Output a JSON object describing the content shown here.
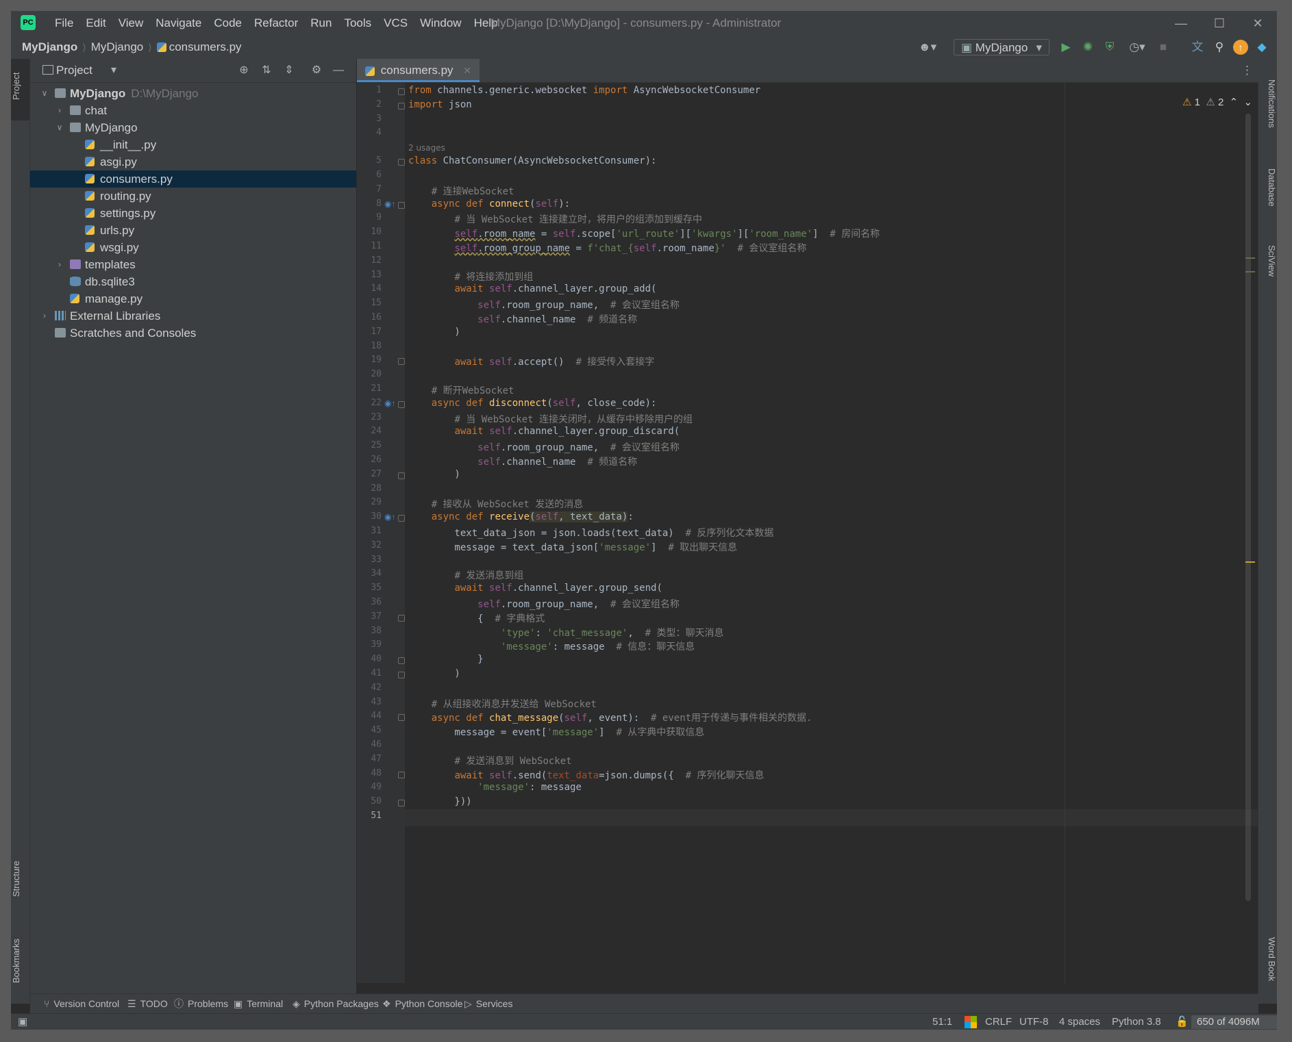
{
  "window": {
    "menus": [
      "File",
      "Edit",
      "View",
      "Navigate",
      "Code",
      "Refactor",
      "Run",
      "Tools",
      "VCS",
      "Window",
      "Help"
    ],
    "title": "MyDjango [D:\\MyDjango] - consumers.py - Administrator"
  },
  "navbar": {
    "crumbs": [
      "MyDjango",
      "MyDjango",
      "consumers.py"
    ],
    "run_config": "MyDjango"
  },
  "project": {
    "title": "Project",
    "tree": [
      {
        "label": "MyDjango",
        "hint": "D:\\MyDjango",
        "depth": 0,
        "type": "folder",
        "open": true,
        "bold": true
      },
      {
        "label": "chat",
        "depth": 1,
        "type": "folder",
        "open": false
      },
      {
        "label": "MyDjango",
        "depth": 1,
        "type": "folder",
        "open": true
      },
      {
        "label": "__init__.py",
        "depth": 2,
        "type": "py"
      },
      {
        "label": "asgi.py",
        "depth": 2,
        "type": "py"
      },
      {
        "label": "consumers.py",
        "depth": 2,
        "type": "py",
        "selected": true
      },
      {
        "label": "routing.py",
        "depth": 2,
        "type": "py"
      },
      {
        "label": "settings.py",
        "depth": 2,
        "type": "py"
      },
      {
        "label": "urls.py",
        "depth": 2,
        "type": "py"
      },
      {
        "label": "wsgi.py",
        "depth": 2,
        "type": "py"
      },
      {
        "label": "templates",
        "depth": 1,
        "type": "folder-purple",
        "open": false
      },
      {
        "label": "db.sqlite3",
        "depth": 1,
        "type": "db"
      },
      {
        "label": "manage.py",
        "depth": 1,
        "type": "py"
      },
      {
        "label": "External Libraries",
        "depth": 0,
        "type": "lib",
        "open": false
      },
      {
        "label": "Scratches and Consoles",
        "depth": 0,
        "type": "scratch"
      }
    ]
  },
  "side_tabs": {
    "left": [
      "Project",
      "Structure",
      "Bookmarks"
    ],
    "right": [
      "Notifications",
      "Database",
      "SciView",
      "Word Book"
    ]
  },
  "editor": {
    "tab": "consumers.py",
    "inspections": {
      "warnings": "1",
      "weak_warnings": "2"
    },
    "usages_hint": "2 usages",
    "current_line": 51,
    "lines": [
      [
        [
          "kw",
          "from "
        ],
        [
          "",
          "channels.generic.websocket "
        ],
        [
          "kw",
          "import "
        ],
        [
          "",
          "AsyncWebsocketConsumer"
        ]
      ],
      [
        [
          "kw",
          "import "
        ],
        [
          "",
          "json"
        ]
      ],
      [],
      [],
      [
        [
          "kw",
          "class "
        ],
        [
          "",
          "ChatConsumer(AsyncWebsocketConsumer):"
        ]
      ],
      [],
      [
        [
          "",
          "    "
        ],
        [
          "cm",
          "# 连接WebSocket"
        ]
      ],
      [
        [
          "",
          "    "
        ],
        [
          "kw",
          "async def "
        ],
        [
          "fn",
          "connect"
        ],
        [
          "",
          "("
        ],
        [
          "sf",
          "self"
        ],
        [
          "",
          "):"
        ]
      ],
      [
        [
          "",
          "        "
        ],
        [
          "cm",
          "# 当 WebSocket 连接建立时，将用户的组添加到缓存中"
        ]
      ],
      [
        [
          "",
          "        "
        ],
        [
          "sf wavy",
          "self"
        ],
        [
          "wavy",
          ".room_name"
        ],
        [
          "",
          " = "
        ],
        [
          "sf",
          "self"
        ],
        [
          "",
          ".scope["
        ],
        [
          "st",
          "'url_route'"
        ],
        [
          "",
          "]["
        ],
        [
          "st",
          "'kwargs'"
        ],
        [
          "",
          "]["
        ],
        [
          "st",
          "'room_name'"
        ],
        [
          "",
          "]  "
        ],
        [
          "cm",
          "# 房间名称"
        ]
      ],
      [
        [
          "",
          "        "
        ],
        [
          "sf wavy",
          "self"
        ],
        [
          "wavy",
          ".room_group_name"
        ],
        [
          "",
          " = "
        ],
        [
          "st",
          "f'chat_{"
        ],
        [
          "sf",
          "self"
        ],
        [
          "",
          ".room_name"
        ],
        [
          "st",
          "}'"
        ],
        [
          "",
          "  "
        ],
        [
          "cm",
          "# 会议室组名称"
        ]
      ],
      [],
      [
        [
          "",
          "        "
        ],
        [
          "cm",
          "# 将连接添加到组"
        ]
      ],
      [
        [
          "",
          "        "
        ],
        [
          "kw",
          "await "
        ],
        [
          "sf",
          "self"
        ],
        [
          "",
          ".channel_layer.group_add("
        ]
      ],
      [
        [
          "",
          "            "
        ],
        [
          "sf",
          "self"
        ],
        [
          "",
          ".room_group_name,  "
        ],
        [
          "cm",
          "# 会议室组名称"
        ]
      ],
      [
        [
          "",
          "            "
        ],
        [
          "sf",
          "self"
        ],
        [
          "",
          ".channel_name  "
        ],
        [
          "cm",
          "# 频道名称"
        ]
      ],
      [
        [
          "",
          "        )"
        ]
      ],
      [],
      [
        [
          "",
          "        "
        ],
        [
          "kw",
          "await "
        ],
        [
          "sf",
          "self"
        ],
        [
          "",
          ".accept()  "
        ],
        [
          "cm",
          "# 接受传入套接字"
        ]
      ],
      [],
      [
        [
          "",
          "    "
        ],
        [
          "cm",
          "# 断开WebSocket"
        ]
      ],
      [
        [
          "",
          "    "
        ],
        [
          "kw",
          "async def "
        ],
        [
          "fn",
          "disconnect"
        ],
        [
          "",
          "("
        ],
        [
          "sf",
          "self"
        ],
        [
          "",
          ", close_code):"
        ]
      ],
      [
        [
          "",
          "        "
        ],
        [
          "cm",
          "# 当 WebSocket 连接关闭时，从缓存中移除用户的组"
        ]
      ],
      [
        [
          "",
          "        "
        ],
        [
          "kw",
          "await "
        ],
        [
          "sf",
          "self"
        ],
        [
          "",
          ".channel_layer.group_discard("
        ]
      ],
      [
        [
          "",
          "            "
        ],
        [
          "sf",
          "self"
        ],
        [
          "",
          ".room_group_name,  "
        ],
        [
          "cm",
          "# 会议室组名称"
        ]
      ],
      [
        [
          "",
          "            "
        ],
        [
          "sf",
          "self"
        ],
        [
          "",
          ".channel_name  "
        ],
        [
          "cm",
          "# 频道名称"
        ]
      ],
      [
        [
          "",
          "        )"
        ]
      ],
      [],
      [
        [
          "",
          "    "
        ],
        [
          "cm",
          "# 接收从 WebSocket 发送的消息"
        ]
      ],
      [
        [
          "",
          "    "
        ],
        [
          "kw",
          "async def "
        ],
        [
          "fn",
          "receive"
        ],
        [
          "hl",
          "("
        ],
        [
          "sf hl",
          "self"
        ],
        [
          "hl",
          ", text_data)"
        ],
        [
          "",
          ":"
        ]
      ],
      [
        [
          "",
          "        text_data_json = json.loads(text_data)  "
        ],
        [
          "cm",
          "# 反序列化文本数据"
        ]
      ],
      [
        [
          "",
          "        message = text_data_json["
        ],
        [
          "st",
          "'message'"
        ],
        [
          "",
          "]  "
        ],
        [
          "cm",
          "# 取出聊天信息"
        ]
      ],
      [],
      [
        [
          "",
          "        "
        ],
        [
          "cm",
          "# 发送消息到组"
        ]
      ],
      [
        [
          "",
          "        "
        ],
        [
          "kw",
          "await "
        ],
        [
          "sf",
          "self"
        ],
        [
          "",
          ".channel_layer.group_send("
        ]
      ],
      [
        [
          "",
          "            "
        ],
        [
          "sf",
          "self"
        ],
        [
          "",
          ".room_group_name,  "
        ],
        [
          "cm",
          "# 会议室组名称"
        ]
      ],
      [
        [
          "",
          "            {  "
        ],
        [
          "cm",
          "# 字典格式"
        ]
      ],
      [
        [
          "",
          "                "
        ],
        [
          "st",
          "'type'"
        ],
        [
          "",
          ": "
        ],
        [
          "st",
          "'chat_message'"
        ],
        [
          "",
          ",  "
        ],
        [
          "cm",
          "# 类型：聊天消息"
        ]
      ],
      [
        [
          "",
          "                "
        ],
        [
          "st",
          "'message'"
        ],
        [
          "",
          ": message  "
        ],
        [
          "cm",
          "# 信息：聊天信息"
        ]
      ],
      [
        [
          "",
          "            }"
        ]
      ],
      [
        [
          "",
          "        )"
        ]
      ],
      [],
      [
        [
          "",
          "    "
        ],
        [
          "cm",
          "# 从组接收消息并发送给 WebSocket"
        ]
      ],
      [
        [
          "",
          "    "
        ],
        [
          "kw",
          "async def "
        ],
        [
          "fn",
          "chat_message"
        ],
        [
          "",
          "("
        ],
        [
          "sf",
          "self"
        ],
        [
          "",
          ", event):  "
        ],
        [
          "cm",
          "# event用于传递与事件相关的数据."
        ]
      ],
      [
        [
          "",
          "        message = event["
        ],
        [
          "st",
          "'message'"
        ],
        [
          "",
          "]  "
        ],
        [
          "cm",
          "# 从字典中获取信息"
        ]
      ],
      [],
      [
        [
          "",
          "        "
        ],
        [
          "cm",
          "# 发送消息到 WebSocket"
        ]
      ],
      [
        [
          "",
          "        "
        ],
        [
          "kw",
          "await "
        ],
        [
          "sf",
          "self"
        ],
        [
          "",
          ".send("
        ],
        [
          "pa",
          "text_data"
        ],
        [
          "",
          "=json.dumps({  "
        ],
        [
          "cm",
          "# 序列化聊天信息"
        ]
      ],
      [
        [
          "",
          "            "
        ],
        [
          "st",
          "'message'"
        ],
        [
          "",
          ": message"
        ]
      ],
      [
        [
          "",
          "        }))"
        ]
      ],
      []
    ]
  },
  "toolwindows": [
    "Version Control",
    "TODO",
    "Problems",
    "Terminal",
    "Python Packages",
    "Python Console",
    "Services"
  ],
  "statusbar": {
    "position": "51:1",
    "line_sep": "CRLF",
    "encoding": "UTF-8",
    "indent": "4 spaces",
    "interpreter": "Python 3.8",
    "memory": "650 of 4096M"
  }
}
